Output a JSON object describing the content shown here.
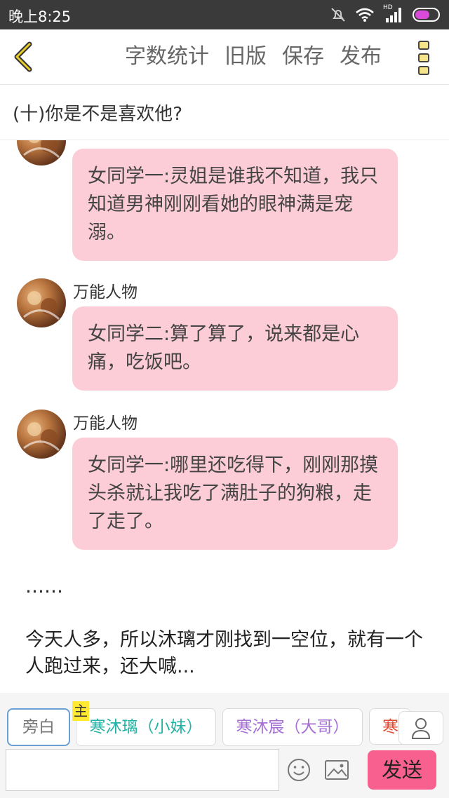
{
  "status_bar": {
    "time": "晚上8:25",
    "network": "HD"
  },
  "nav": {
    "back_icon": "chevron-left-icon",
    "actions": [
      "字数统计",
      "旧版",
      "保存",
      "发布"
    ],
    "more_icon": "more-vertical-icon"
  },
  "chapter": {
    "title": "(十)你是不是喜欢他?"
  },
  "messages": [
    {
      "sender": "万能人物",
      "text": "女同学一:灵姐是谁我不知道，我只知道男神刚刚看她的眼神满是宠溺。"
    },
    {
      "sender": "万能人物",
      "text": "女同学二:算了算了，说来都是心痛，吃饭吧。"
    },
    {
      "sender": "万能人物",
      "text": "女同学一:哪里还吃得下，刚刚那摸头杀就让我吃了满肚子的狗粮，走了走了。"
    }
  ],
  "narration": [
    "……",
    "今天人多，所以沐璃才刚找到一空位，就有一个人跑过来，还大喊..."
  ],
  "roles": {
    "items": [
      {
        "label": "旁白",
        "color": "#777777"
      },
      {
        "label": "寒沐璃（小妹）",
        "color": "#22b3a6"
      },
      {
        "label": "寒沐宸（大哥）",
        "color": "#a66fd4"
      },
      {
        "label": "寒",
        "color": "#e04a2f"
      }
    ],
    "main_tag": "主"
  },
  "input": {
    "value": "",
    "placeholder": "",
    "send_label": "发送"
  },
  "colors": {
    "bubble": "#fcccd7",
    "send": "#f8608f",
    "accent_selected": "#6a9fd4",
    "main_tag": "#ffe933"
  }
}
